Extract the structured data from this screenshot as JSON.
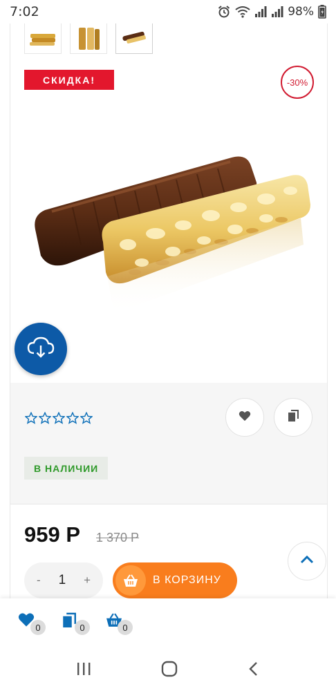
{
  "status_bar": {
    "time": "7:02",
    "battery": "98%"
  },
  "product": {
    "sale_badge": "СКИДКА!",
    "discount_badge": "-30%",
    "stock": "В НАЛИЧИИ",
    "rating": 0,
    "rating_max": 5
  },
  "price": {
    "current": "959 Р",
    "old": "1 370 Р"
  },
  "quantity": {
    "minus": "-",
    "value": "1",
    "plus": "+"
  },
  "cart_button": {
    "label": "В КОРЗИНУ"
  },
  "counters": {
    "wishlist": "0",
    "compare": "0",
    "basket": "0"
  },
  "colors": {
    "sale_red": "#e3172d",
    "brand_blue": "#0d5aa7",
    "cart_orange": "#f97d1d",
    "stock_green": "#2f9a2a"
  },
  "icons": [
    "alarm-icon",
    "wifi-icon",
    "signal-icon",
    "battery-icon",
    "cloud-download-icon",
    "heart-icon",
    "compare-icon",
    "basket-icon",
    "chevron-up-icon",
    "recent-apps-icon",
    "home-icon",
    "back-icon",
    "star-icon"
  ]
}
